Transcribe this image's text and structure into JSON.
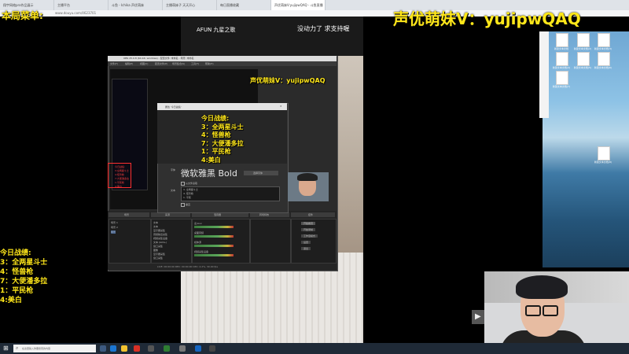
{
  "browser": {
    "tabs": [
      "翔宇网络pro作品展示",
      "主播平台",
      "斗鱼 - Ichika 声优萌妹",
      "主播萌妹子 天天开心",
      "每日直播收藏",
      "声优萌妹V:yujipwQAQ - 斗鱼直播"
    ],
    "url": "www.douyu.com/4623701"
  },
  "overlay": {
    "menu_label": "本局菜单:",
    "watermark": "声优萌妹V：yujipwQAQ",
    "small_watermark": "声优萌妹V：yujipwQAQ"
  },
  "stats": {
    "title": "今日战绩:",
    "lines": [
      "3：全两星斗士",
      "4：怪兽枪",
      "7：大便潘多拉",
      "1：平民枪",
      "4:美白"
    ]
  },
  "left_stats": {
    "title": "今日战绩:",
    "lines": [
      "3：全两星斗士",
      "4：怪兽枪",
      "7：大便潘多拉",
      "1：平民枪",
      "4:美白"
    ]
  },
  "obs_stats": {
    "lines": [
      "今日战绩:",
      "3:全两星斗士",
      "4:怪兽枪",
      "7:大便潘多拉",
      "1:平民枪",
      "4:美白"
    ]
  },
  "stream_page": {
    "logo": "AFUN 九星之歌",
    "slogan": "没动力了 求支持喔"
  },
  "obs": {
    "title": "OBS 25.0.8 (64-bit, windows) - 配置文件: 未命名 - 场景: 未命名",
    "menu": [
      "文件(F)",
      "编辑(E)",
      "视图(V)",
      "配置文件(P)",
      "场景集合(S)",
      "工具(T)",
      "帮助(H)"
    ],
    "dock_scenes": "场景",
    "dock_sources": "来源",
    "dock_mixer": "混音器",
    "dock_transitions": "转场特效",
    "dock_controls": "控件",
    "scene_items": [
      "场景 1",
      "场景 2",
      "场景"
    ],
    "source_items": [
      "文本",
      "文本",
      "显示器采集",
      "音频输出采集",
      "视频采集设备",
      "文本 (GDI+)",
      "窗口采集",
      "图像",
      "显示器采集",
      "窗口采集"
    ],
    "mixer_items": [
      "麦/Aux",
      "桌面音频",
      "媒体源",
      "视频采集设备"
    ],
    "controls": [
      "开始推流",
      "开始录制",
      "工作室模式",
      "设置",
      "退出"
    ],
    "status": "LIVE: 00:00:00  REC: 00:00:00  CPU: 4.2%, 30.00 fps"
  },
  "props_dialog": {
    "title": "属性 '今日战绩'",
    "font_label": "字体",
    "font_name": "微软雅黑 Bold",
    "font_button": "选择字体",
    "text_label": "文本",
    "text_lines": [
      "3. 全两星斗士",
      "4. 怪兽枪",
      "1. 平民"
    ],
    "file_checkbox": "从文件读取",
    "vertical_checkbox": "垂直"
  },
  "desktop": {
    "icons": [
      "新建文本文档",
      "新建文本文档(2)",
      "新建文本文档(3)",
      "新建文本文档(4)",
      "新建文本文档(5)",
      "新建文本文档(6)",
      "新建文本文档(7)",
      "新建文本文档(8)"
    ]
  },
  "taskbar": {
    "search_placeholder": "在这里输入你要搜索的内容"
  }
}
